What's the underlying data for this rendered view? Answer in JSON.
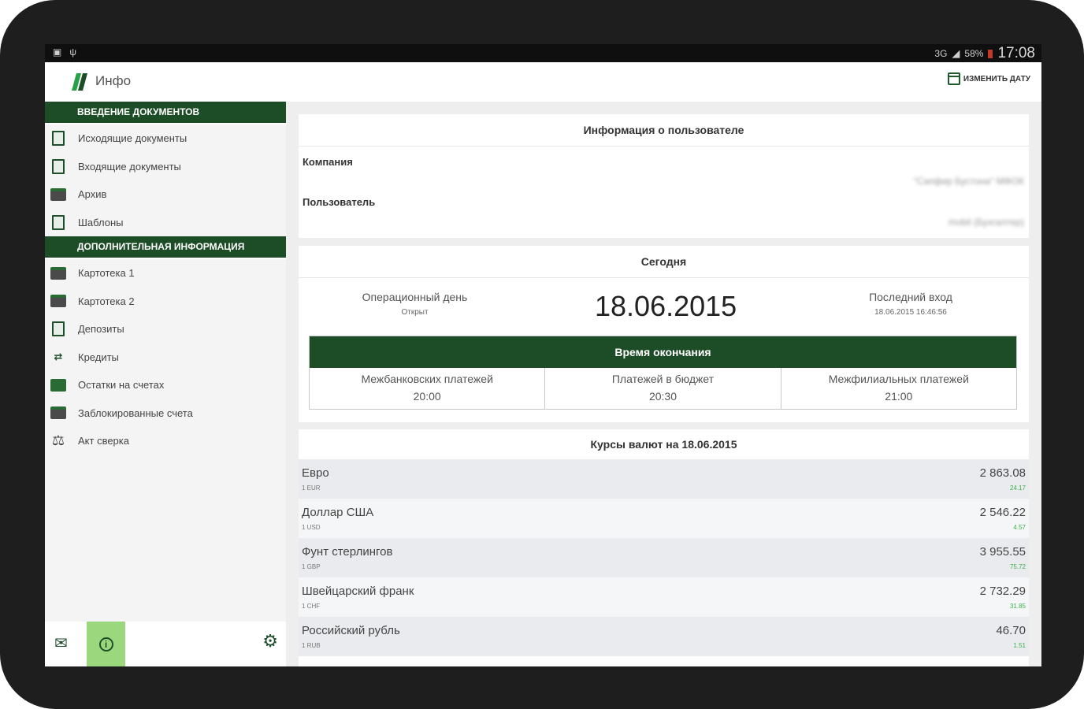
{
  "status_bar": {
    "left_icons": [
      "screenshot-icon",
      "usb-icon"
    ],
    "signal": "3G",
    "battery": "58%",
    "time": "17:08"
  },
  "app_bar": {
    "title": "Инфо",
    "change_date_label": "ИЗМЕНИТЬ ДАТУ"
  },
  "sidebar": {
    "section1": {
      "title": "ВВЕДЕНИЕ ДОКУМЕНТОВ",
      "items": [
        {
          "label": "Исходящие документы",
          "icon": "outgoing-docs-icon"
        },
        {
          "label": "Входящие документы",
          "icon": "incoming-docs-icon"
        },
        {
          "label": "Архив",
          "icon": "archive-icon"
        },
        {
          "label": "Шаблоны",
          "icon": "templates-icon"
        }
      ]
    },
    "section2": {
      "title": "ДОПОЛНИТЕЛЬНАЯ ИНФОРМАЦИЯ",
      "items": [
        {
          "label": "Картотека 1",
          "icon": "card-index-icon"
        },
        {
          "label": "Картотека 2",
          "icon": "card-index-icon"
        },
        {
          "label": "Депозиты",
          "icon": "deposits-icon"
        },
        {
          "label": "Кредиты",
          "icon": "credits-icon"
        },
        {
          "label": "Остатки на счетах",
          "icon": "balances-icon"
        },
        {
          "label": "Заблокированные счета",
          "icon": "blocked-accounts-icon"
        },
        {
          "label": "Акт сверка",
          "icon": "scales-icon"
        }
      ]
    },
    "bottom_icons": [
      "mail-icon",
      "info-icon",
      "gear-icon"
    ]
  },
  "user_info": {
    "title": "Информация о пользователе",
    "company_label": "Компания",
    "company_value": "\"Сапфир Бустона\" МФОК",
    "user_label": "Пользователь",
    "user_value": "mobil (Бухгалтер)"
  },
  "today": {
    "title": "Сегодня",
    "op_day_label": "Операционный день",
    "op_day_status": "Открыт",
    "date": "18.06.2015",
    "last_login_label": "Последний вход",
    "last_login_value": "18.06.2015 16:46:56",
    "end_time": {
      "title": "Время окончания",
      "columns": [
        {
          "label": "Межбанковских платежей",
          "time": "20:00"
        },
        {
          "label": "Платежей в бюджет",
          "time": "20:30"
        },
        {
          "label": "Межфилиальных платежей",
          "time": "21:00"
        }
      ]
    }
  },
  "rates": {
    "title": "Курсы валют на 18.06.2015",
    "items": [
      {
        "name": "Евро",
        "code": "1 EUR",
        "value": "2 863.08",
        "change": "24.17"
      },
      {
        "name": "Доллар США",
        "code": "1 USD",
        "value": "2 546.22",
        "change": "4.57"
      },
      {
        "name": "Фунт стерлингов",
        "code": "1 GBP",
        "value": "3 955.55",
        "change": "75.72"
      },
      {
        "name": "Швейцарский франк",
        "code": "1 CHF",
        "value": "2 732.29",
        "change": "31.85"
      },
      {
        "name": "Российский рубль",
        "code": "1 RUB",
        "value": "46.70",
        "change": "1.51"
      }
    ]
  },
  "colors": {
    "brand_green": "#1d4d26",
    "active_green": "#9bd87d",
    "positive_change": "#3cb04a"
  }
}
